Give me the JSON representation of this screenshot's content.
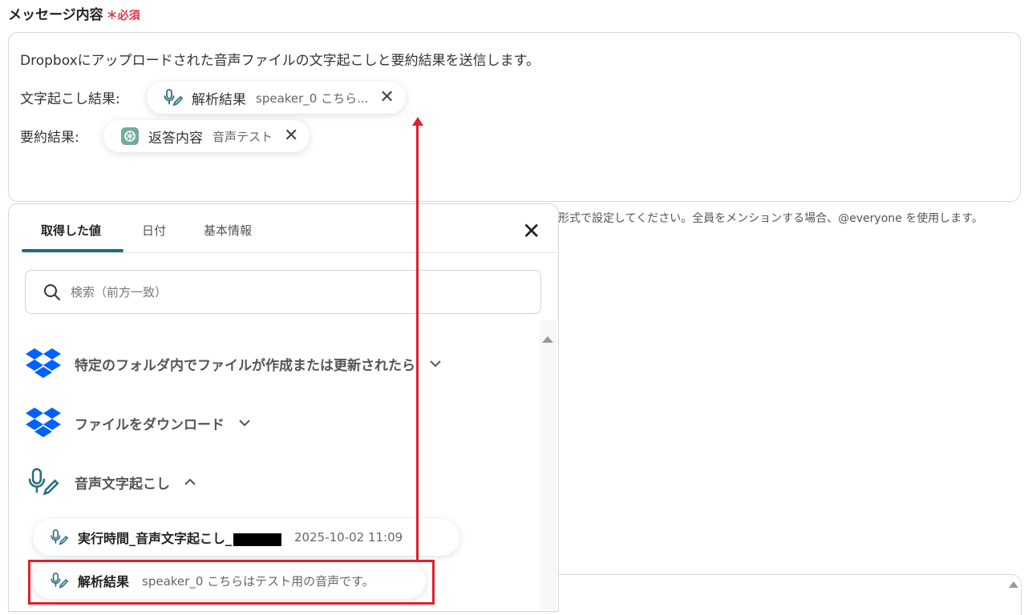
{
  "field": {
    "label": "メッセージ内容",
    "required_mark": "＊",
    "required_text": "必須"
  },
  "editor": {
    "line1": "Dropboxにアップロードされた音声ファイルの文字起こしと要約結果を送信します。",
    "line2_label": "文字起こし結果:",
    "line3_label": "要約結果:",
    "chip1": {
      "name": "解析結果",
      "value": "speaker_0 こちら...",
      "icon": "mic-pen-icon"
    },
    "chip2": {
      "name": "返答内容",
      "value": "音声テスト",
      "icon": "chatgpt-icon"
    }
  },
  "hint": "形式で設定してください。全員をメンションする場合、@everyone を使用します。",
  "panel": {
    "tabs": [
      "取得した値",
      "日付",
      "基本情報"
    ],
    "active_tab": "取得した値",
    "search_placeholder": "検索（前方一致）",
    "groups": [
      {
        "label": "特定のフォルダ内でファイルが作成または更新されたら",
        "icon": "dropbox-icon",
        "expanded": false
      },
      {
        "label": "ファイルをダウンロード",
        "icon": "dropbox-icon",
        "expanded": false
      },
      {
        "label": "音声文字起こし",
        "icon": "mic-pen-icon",
        "expanded": true
      }
    ],
    "items": [
      {
        "name": "実行時間_音声文字起こし_",
        "value": "2025-10-02 11:09"
      },
      {
        "name": "解析結果",
        "value": "speaker_0 こちらはテスト用の音声です。"
      }
    ]
  },
  "colors": {
    "accent": "#1e6f82",
    "required": "#e0334a",
    "highlight": "#e0202a",
    "dropbox": "#0061fe",
    "chatgpt": "#74aa9c"
  }
}
